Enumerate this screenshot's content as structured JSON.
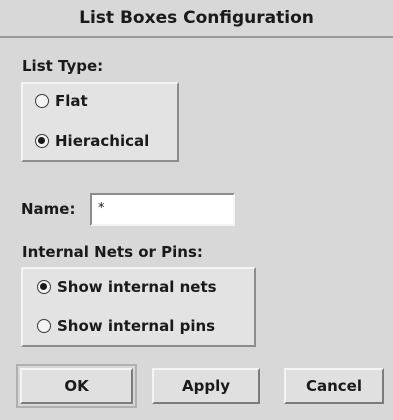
{
  "window": {
    "title": "List Boxes Configuration"
  },
  "list_type": {
    "label": "List Type:",
    "options": [
      {
        "label": "Flat",
        "checked": false
      },
      {
        "label": "Hierachical",
        "checked": true
      }
    ]
  },
  "name_field": {
    "label": "Name:",
    "value": "*"
  },
  "internal": {
    "label": "Internal Nets or Pins:",
    "options": [
      {
        "label": "Show internal nets",
        "checked": true
      },
      {
        "label": "Show internal pins",
        "checked": false
      }
    ]
  },
  "buttons": {
    "ok": "OK",
    "apply": "Apply",
    "cancel": "Cancel"
  }
}
